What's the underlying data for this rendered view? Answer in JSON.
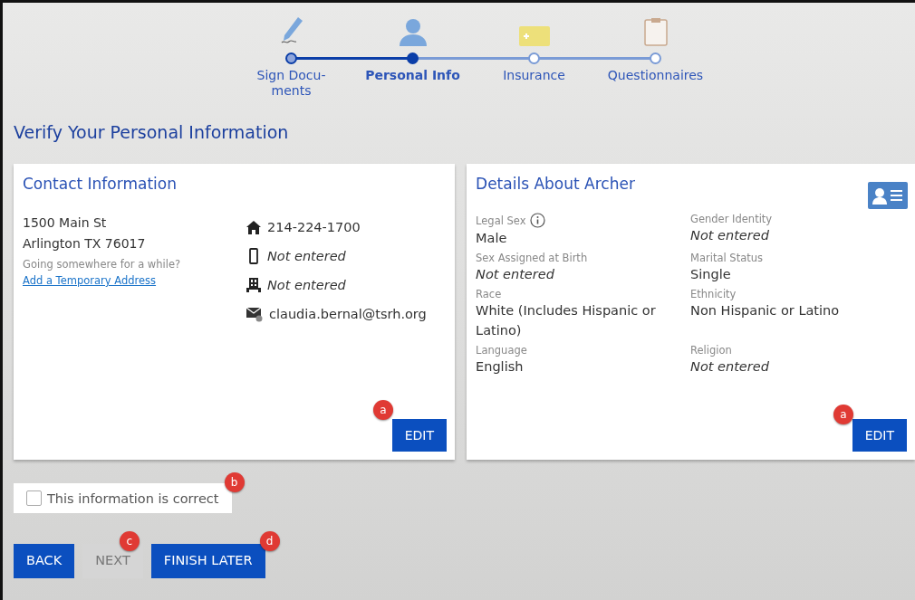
{
  "steps": [
    {
      "label": "Sign Docu-\nments",
      "selected": false,
      "completed": true
    },
    {
      "label": "Personal Info",
      "selected": true,
      "completed": false
    },
    {
      "label": "Insurance",
      "selected": false,
      "completed": false
    },
    {
      "label": "Questionnaires",
      "selected": false,
      "completed": false
    }
  ],
  "page_title": "Verify Your Personal Information",
  "contact": {
    "title": "Contact Information",
    "address": [
      "1500 Main St",
      "Arlington TX 76017"
    ],
    "hint": "Going somewhere for a while?",
    "link": "Add a Temporary Address",
    "rows": [
      {
        "kind": "home",
        "value": "214-224-1700",
        "empty": false
      },
      {
        "kind": "mobile",
        "value": "Not entered",
        "empty": true
      },
      {
        "kind": "work",
        "value": "Not entered",
        "empty": true
      },
      {
        "kind": "email",
        "value": "claudia.bernal@tsrh.org",
        "empty": false
      }
    ],
    "button": "EDIT",
    "marker": "a"
  },
  "details": {
    "title": "Details About Archer",
    "fields": [
      {
        "label": "Legal Sex",
        "value": "Male",
        "empty": false,
        "info": true
      },
      {
        "label": "Gender Identity",
        "value": "Not entered",
        "empty": true,
        "info": false
      },
      {
        "label": "Sex Assigned at Birth",
        "value": "Not entered",
        "empty": true,
        "info": false
      },
      {
        "label": "Marital Status",
        "value": "Single",
        "empty": false,
        "info": false
      },
      {
        "label": "Race",
        "value": "White (Includes Hispanic or Latino)",
        "empty": false,
        "info": false
      },
      {
        "label": "Ethnicity",
        "value": "Non Hispanic or Latino",
        "empty": false,
        "info": false
      },
      {
        "label": "Language",
        "value": "English",
        "empty": false,
        "info": false
      },
      {
        "label": "Religion",
        "value": "Not entered",
        "empty": true,
        "info": false
      }
    ],
    "button": "EDIT",
    "marker": "a"
  },
  "confirm": {
    "label": "This information is correct",
    "checked": false,
    "marker": "b"
  },
  "buttons": [
    {
      "label": "BACK",
      "disabled": false
    },
    {
      "label": "NEXT",
      "disabled": true,
      "marker": "c"
    },
    {
      "label": "FINISH LATER",
      "disabled": false,
      "marker": "d"
    }
  ]
}
